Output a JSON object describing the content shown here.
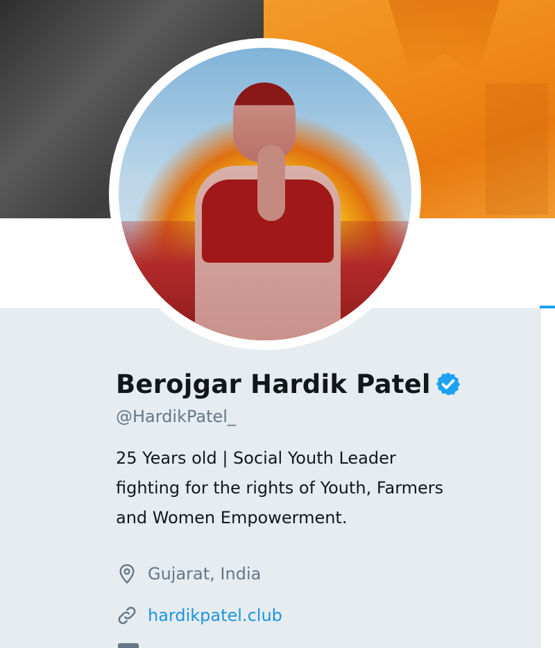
{
  "profile": {
    "name": "Berojgar Hardik Patel",
    "handle": "@HardikPatel_",
    "bio_lines": [
      "25 Years old | Social Youth Leader",
      "fighting for the rights of Youth, Farmers",
      "and Women Empowerment."
    ],
    "location": "Gujarat, India",
    "website": "hardikpatel.club",
    "verified": true
  },
  "icons": {
    "verified": "verified-badge-icon",
    "location": "location-pin-icon",
    "link": "link-icon"
  },
  "colors": {
    "accent": "#1da1f2",
    "link": "#1b95e0",
    "verified": "#1da1f2",
    "secondary_text": "#657786",
    "background": "#e6ecf0"
  }
}
